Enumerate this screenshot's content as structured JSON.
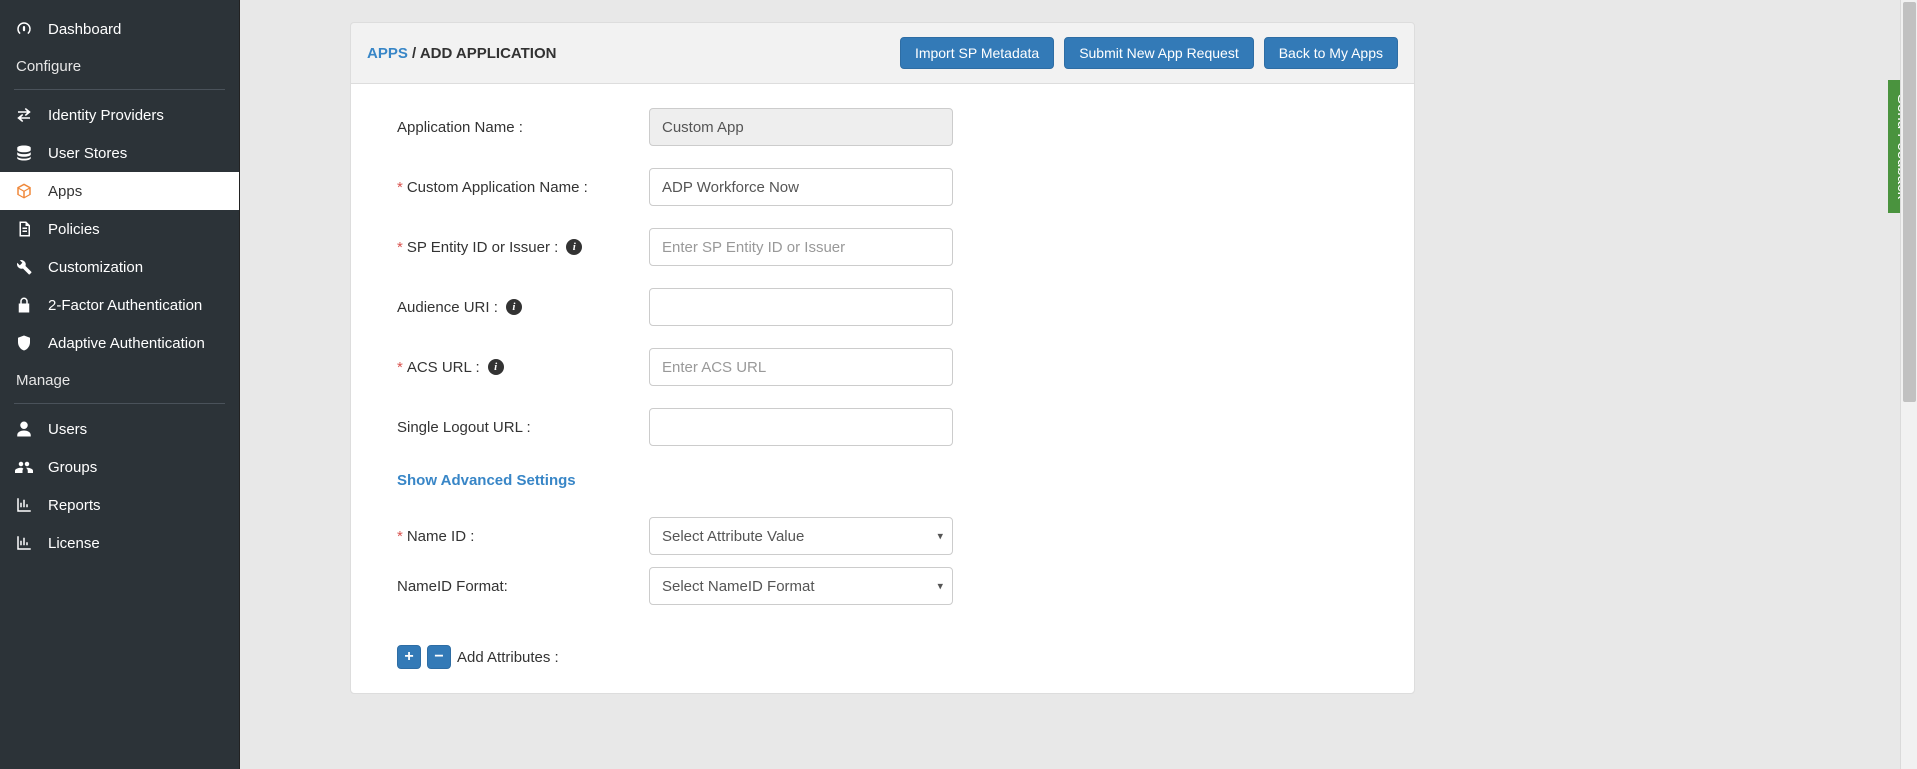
{
  "sidebar": {
    "dashboard": "Dashboard",
    "configure_label": "Configure",
    "manage_label": "Manage",
    "items": {
      "idp": "Identity Providers",
      "userstores": "User Stores",
      "apps": "Apps",
      "policies": "Policies",
      "customization": "Customization",
      "twofa": "2-Factor Authentication",
      "adaptive": "Adaptive Authentication",
      "users": "Users",
      "groups": "Groups",
      "reports": "Reports",
      "license": "License"
    }
  },
  "breadcrumb": {
    "apps": "APPS",
    "sep": " / ",
    "current": "ADD APPLICATION"
  },
  "header_buttons": {
    "import": "Import SP Metadata",
    "submit": "Submit New App Request",
    "back": "Back to My Apps"
  },
  "form": {
    "app_name_label": "Application Name :",
    "app_name_value": "Custom App",
    "custom_name_label": "Custom Application Name :",
    "custom_name_value": "ADP Workforce Now",
    "sp_entity_label": "SP Entity ID or Issuer :",
    "sp_entity_placeholder": "Enter SP Entity ID or Issuer",
    "audience_label": "Audience URI :",
    "acs_label": "ACS URL :",
    "acs_placeholder": "Enter ACS URL",
    "slo_label": "Single Logout URL :",
    "advanced_link": "Show Advanced Settings",
    "nameid_label": "Name ID :",
    "nameid_select": "Select Attribute Value",
    "nameid_format_label": "NameID Format:",
    "nameid_format_select": "Select NameID Format",
    "add_attributes_label": "Add Attributes :"
  },
  "feedback": "Send Feedback"
}
